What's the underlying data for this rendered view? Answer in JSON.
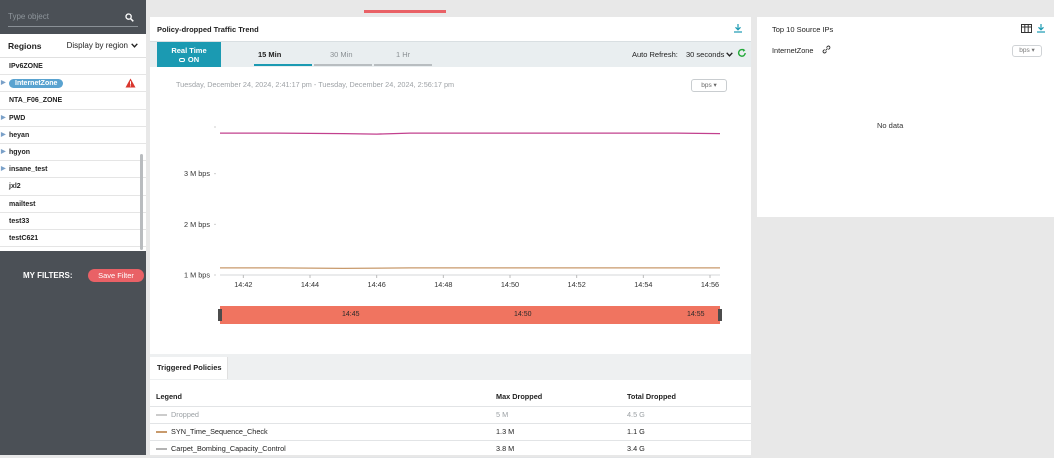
{
  "sidebar": {
    "search_placeholder": "Type object",
    "regions_title": "Regions",
    "display_label": "Display by region",
    "regions": [
      {
        "label": "IPv6ZONE",
        "expandable": false,
        "selected": false,
        "warning": false
      },
      {
        "label": "InternetZone",
        "expandable": true,
        "selected": true,
        "warning": true
      },
      {
        "label": "NTA_F06_ZONE",
        "expandable": false,
        "selected": false,
        "warning": false
      },
      {
        "label": "PWD",
        "expandable": true,
        "selected": false,
        "warning": false
      },
      {
        "label": "heyan",
        "expandable": true,
        "selected": false,
        "warning": false
      },
      {
        "label": "hgyon",
        "expandable": true,
        "selected": false,
        "warning": false
      },
      {
        "label": "insane_test",
        "expandable": true,
        "selected": false,
        "warning": false
      },
      {
        "label": "jxl2",
        "expandable": false,
        "selected": false,
        "warning": false
      },
      {
        "label": "mailtest",
        "expandable": false,
        "selected": false,
        "warning": false
      },
      {
        "label": "test33",
        "expandable": false,
        "selected": false,
        "warning": false
      },
      {
        "label": "testC621",
        "expandable": false,
        "selected": false,
        "warning": false
      }
    ],
    "filters_label": "MY FILTERS:",
    "save_filter_label": "Save Filter"
  },
  "trend": {
    "title": "Policy-dropped Traffic Trend",
    "realtime_label": "Real Time",
    "realtime_state": "ON",
    "tabs": [
      "15 Min",
      "30 Min",
      "1 Hr"
    ],
    "active_tab": 0,
    "auto_refresh_label": "Auto Refresh:",
    "auto_refresh_value": "30 seconds",
    "range_text": "Tuesday, December 24, 2024, 2:41:17 pm - Tuesday, December 24, 2024, 2:56:17 pm",
    "unit": "bps"
  },
  "chart_data": {
    "type": "line",
    "x_ticks": [
      "14:42",
      "14:44",
      "14:46",
      "14:48",
      "14:50",
      "14:52",
      "14:54",
      "14:56"
    ],
    "y_ticks": [
      "1 M bps",
      "2 M bps",
      "3 M bps"
    ],
    "y_tick_values": [
      1000000,
      2000000,
      3000000
    ],
    "navigator_labels": [
      "14:45",
      "14:50",
      "14:55"
    ],
    "series": [
      {
        "name": "Carpet_Bombing_Capacity_Control",
        "color": "#c2408e",
        "x": [
          "14:41",
          "14:43",
          "14:45",
          "14:46",
          "14:47",
          "14:49",
          "14:51",
          "14:53",
          "14:55",
          "14:56"
        ],
        "values": [
          3800000,
          3800000,
          3790000,
          3780000,
          3800000,
          3800000,
          3800000,
          3800000,
          3800000,
          3790000
        ]
      },
      {
        "name": "SYN_Time_Sequence_Check",
        "color": "#c89a6c",
        "x": [
          "14:41",
          "14:43",
          "14:45",
          "14:47",
          "14:49",
          "14:51",
          "14:53",
          "14:55",
          "14:56"
        ],
        "values": [
          1140000,
          1140000,
          1130000,
          1140000,
          1140000,
          1140000,
          1140000,
          1140000,
          1140000
        ]
      }
    ],
    "x_domain_minutes": [
      41.3,
      56.3
    ],
    "y_domain": [
      1000000,
      4000000
    ]
  },
  "policies": {
    "tab_label": "Triggered Policies",
    "columns": [
      "Legend",
      "Max Dropped",
      "Total Dropped"
    ],
    "rows": [
      {
        "legend": "Dropped",
        "max": "5 M",
        "total": "4.5 G",
        "color": "#cccccc",
        "muted": true
      },
      {
        "legend": "SYN_Time_Sequence_Check",
        "max": "1.3 M",
        "total": "1.1 G",
        "color": "#c89a6c",
        "muted": false
      },
      {
        "legend": "Carpet_Bombing_Capacity_Control",
        "max": "3.8 M",
        "total": "3.4 G",
        "color": "#b3b3b3",
        "muted": false
      }
    ]
  },
  "top_sources": {
    "title": "Top 10 Source IPs",
    "zone": "InternetZone",
    "unit": "bps",
    "empty_text": "No data"
  },
  "colors": {
    "accent": "#1b9ab2",
    "alert": "#e96166",
    "navigator": "#f07460"
  }
}
